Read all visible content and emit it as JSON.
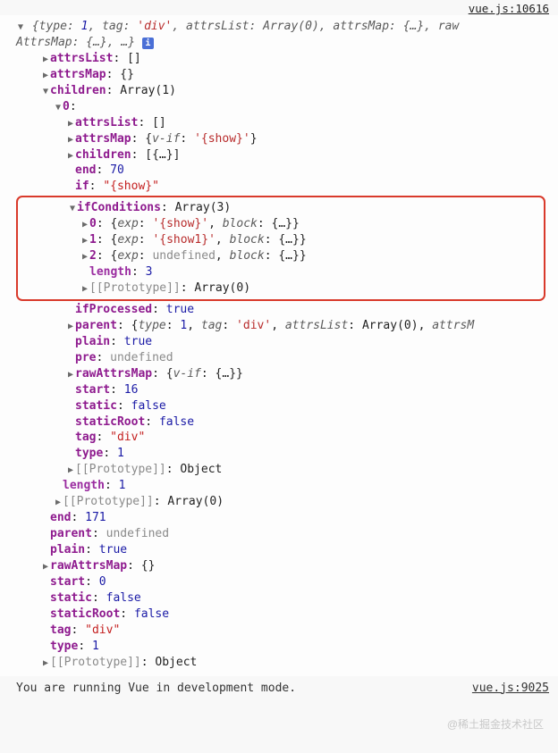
{
  "source_links": {
    "top": "vue.js:10616",
    "bottom": "vue.js:9025"
  },
  "top_summary": {
    "open": "{",
    "parts": [
      {
        "k": "type",
        "v": "1",
        "cls": "num"
      },
      {
        "k": "tag",
        "v": "'div'",
        "cls": "str"
      },
      {
        "k": "attrsList",
        "v": "Array(0)",
        "cls": ""
      },
      {
        "k": "attrsMap",
        "v": "{…}",
        "cls": ""
      },
      {
        "k": "raw",
        "cont": true
      }
    ],
    "cont_key": "AttrsMap",
    "cont_val": "{…}, …}",
    "info": "i"
  },
  "root": {
    "attrsList": "[]",
    "attrsMap": "{}",
    "children_label": "Array(1)",
    "child0": {
      "attrsList": "[]",
      "attrsMap": "{v-if: '{show}'}",
      "children": "[{…}]",
      "end": "70",
      "if": "\"{show}\"",
      "ifConditions": {
        "label": "Array(3)",
        "items": [
          {
            "idx": "0",
            "exp": "'{show}'",
            "block": "{…}"
          },
          {
            "idx": "1",
            "exp": "'{show1}'",
            "block": "{…}"
          },
          {
            "idx": "2",
            "exp": "undefined",
            "block": "{…}"
          }
        ],
        "length": "3",
        "proto": "Array(0)"
      },
      "ifProcessed": "true",
      "parent": "{type: 1, tag: 'div', attrsList: Array(0), attrsM",
      "plain": "true",
      "pre": "undefined",
      "rawAttrsMap": "{v-if: {…}}",
      "start": "16",
      "static": "false",
      "staticRoot": "false",
      "tag": "\"div\"",
      "type": "1",
      "proto": "Object"
    },
    "children_length": "1",
    "children_proto": "Array(0)",
    "end": "171",
    "parent": "undefined",
    "plain": "true",
    "rawAttrsMap": "{}",
    "start": "0",
    "static": "false",
    "staticRoot": "false",
    "tag": "\"div\"",
    "type": "1",
    "proto": "Object"
  },
  "bottom_msg": "You are running Vue in development mode.",
  "watermark": "@稀土掘金技术社区",
  "labels": {
    "attrsList": "attrsList",
    "attrsMap": "attrsMap",
    "children": "children",
    "end": "end",
    "if": "if",
    "ifConditions": "ifConditions",
    "ifProcessed": "ifProcessed",
    "parent": "parent",
    "plain": "plain",
    "pre": "pre",
    "rawAttrsMap": "rawAttrsMap",
    "start": "start",
    "static": "static",
    "staticRoot": "staticRoot",
    "tag": "tag",
    "type": "type",
    "length": "length",
    "proto": "[[Prototype]]",
    "exp": "exp",
    "block": "block"
  }
}
